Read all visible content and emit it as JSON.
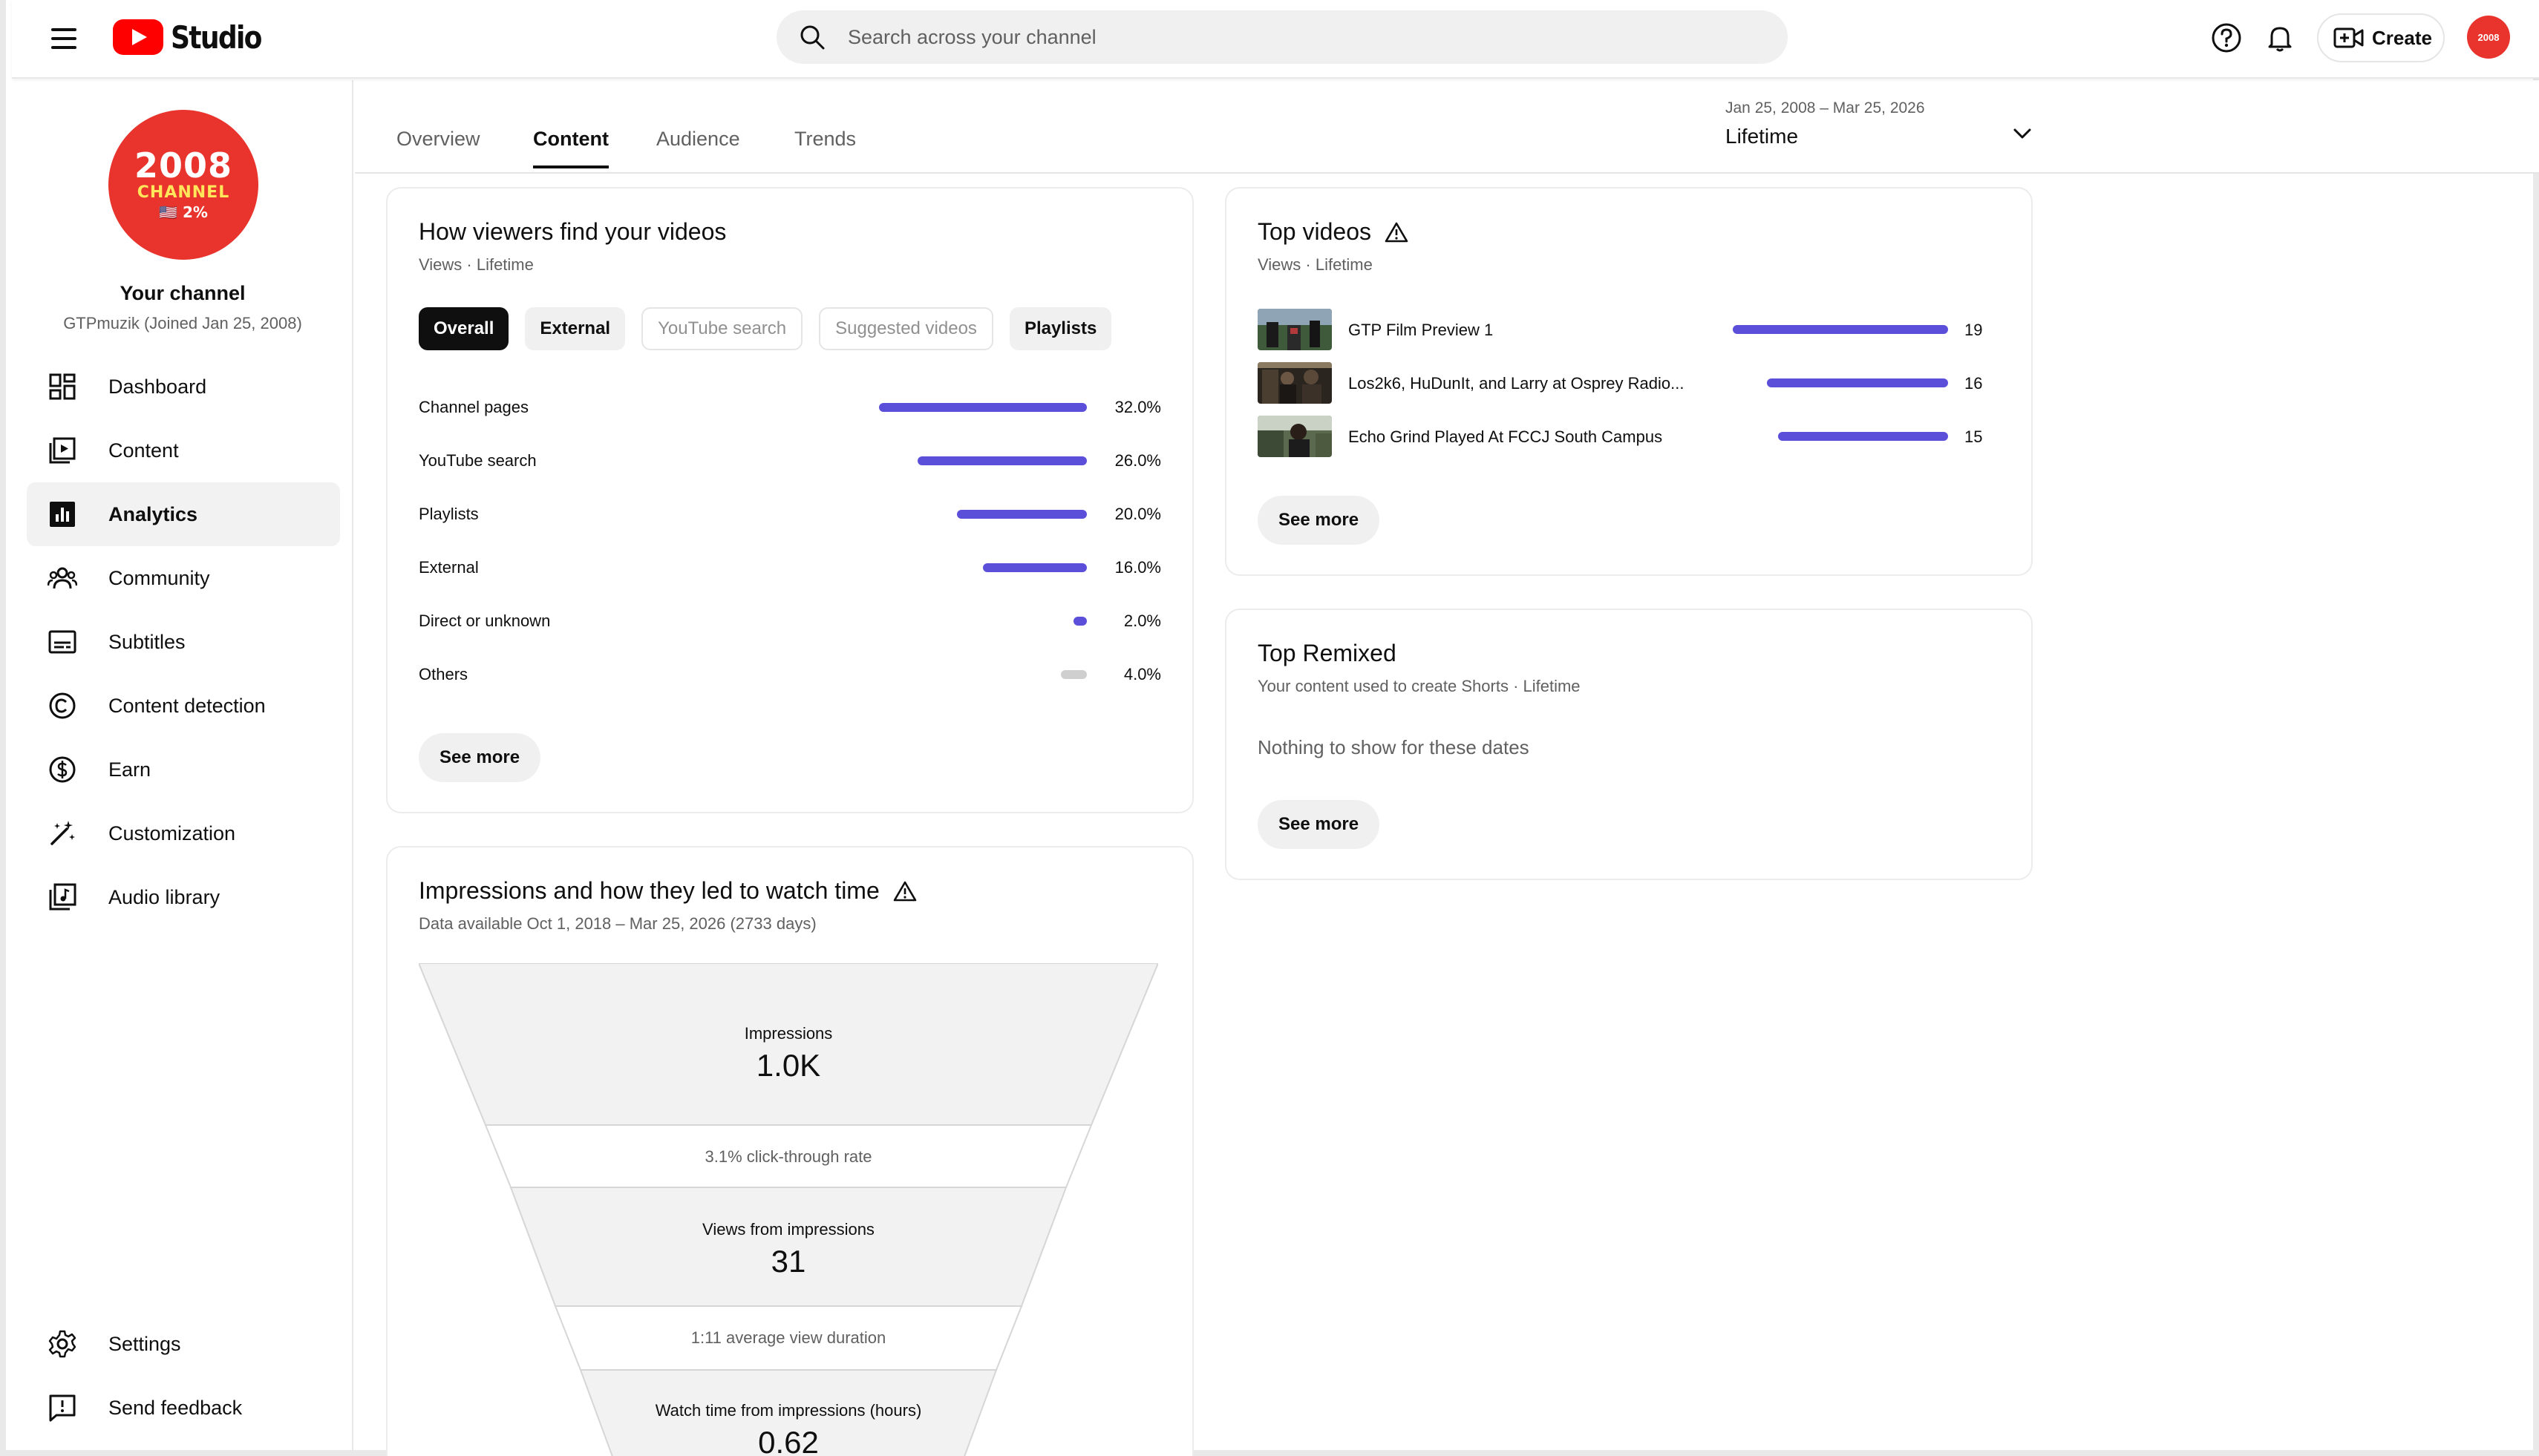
{
  "header": {
    "logo_text": "Studio",
    "search_placeholder": "Search across your channel",
    "create_label": "Create",
    "avatar_text": "2008"
  },
  "sidebar": {
    "avatar": {
      "year": "2008",
      "line2": "CHANNEL",
      "line3": "🇺🇸 2%"
    },
    "channel_title": "Your channel",
    "channel_subtitle": "GTPmuzik (Joined Jan 25, 2008)",
    "items": [
      {
        "label": "Dashboard",
        "icon": "dashboard-icon"
      },
      {
        "label": "Content",
        "icon": "content-icon"
      },
      {
        "label": "Analytics",
        "icon": "analytics-icon",
        "active": true
      },
      {
        "label": "Community",
        "icon": "community-icon"
      },
      {
        "label": "Subtitles",
        "icon": "subtitles-icon"
      },
      {
        "label": "Content detection",
        "icon": "copyright-icon"
      },
      {
        "label": "Earn",
        "icon": "dollar-icon"
      },
      {
        "label": "Customization",
        "icon": "magic-wand-icon"
      },
      {
        "label": "Audio library",
        "icon": "audio-library-icon"
      }
    ],
    "bottom_items": [
      {
        "label": "Settings",
        "icon": "gear-icon"
      },
      {
        "label": "Send feedback",
        "icon": "feedback-icon"
      }
    ]
  },
  "tabs": {
    "items": [
      "Overview",
      "Content",
      "Audience",
      "Trends"
    ],
    "active": "Content"
  },
  "date_range": {
    "range": "Jan 25, 2008 – Mar 25, 2026",
    "label": "Lifetime"
  },
  "traffic_sources": {
    "title": "How viewers find your videos",
    "subtitle": "Views · Lifetime",
    "chips": [
      {
        "label": "Overall",
        "style": "selected"
      },
      {
        "label": "External",
        "style": "filled"
      },
      {
        "label": "YouTube search",
        "style": "outline"
      },
      {
        "label": "Suggested videos",
        "style": "outline"
      },
      {
        "label": "Playlists",
        "style": "filled"
      }
    ],
    "rows": [
      {
        "label": "Channel pages",
        "value": "32.0%",
        "percent": 32.0
      },
      {
        "label": "YouTube search",
        "value": "26.0%",
        "percent": 26.0
      },
      {
        "label": "Playlists",
        "value": "20.0%",
        "percent": 20.0
      },
      {
        "label": "External",
        "value": "16.0%",
        "percent": 16.0
      },
      {
        "label": "Direct or unknown",
        "value": "2.0%",
        "percent": 2.0
      },
      {
        "label": "Others",
        "value": "4.0%",
        "percent": 4.0,
        "grey": true
      }
    ],
    "see_more": "See more"
  },
  "top_videos": {
    "title": "Top videos",
    "subtitle": "Views · Lifetime",
    "rows": [
      {
        "title": "GTP Film Preview 1",
        "views": 19
      },
      {
        "title": "Los2k6, HuDunIt, and Larry at Osprey Radio...",
        "views": 16
      },
      {
        "title": "Echo Grind Played At FCCJ South Campus",
        "views": 15
      }
    ],
    "see_more": "See more"
  },
  "top_remixed": {
    "title": "Top Remixed",
    "subtitle": "Your content used to create Shorts · Lifetime",
    "empty": "Nothing to show for these dates",
    "see_more": "See more"
  },
  "impressions": {
    "title": "Impressions and how they led to watch time",
    "subtitle": "Data available Oct 1, 2018 – Mar 25, 2026 (2733 days)",
    "impressions_label": "Impressions",
    "impressions_value": "1.0K",
    "ctr_note": "3.1% click-through rate",
    "views_label": "Views from impressions",
    "views_value": "31",
    "avd_note": "1:11 average view duration",
    "watch_label": "Watch time from impressions (hours)",
    "watch_value": "0.62"
  },
  "colors": {
    "accent_bar": "#5b4fd9",
    "brand_red": "#ff0000",
    "avatar_red": "#e8342c"
  }
}
